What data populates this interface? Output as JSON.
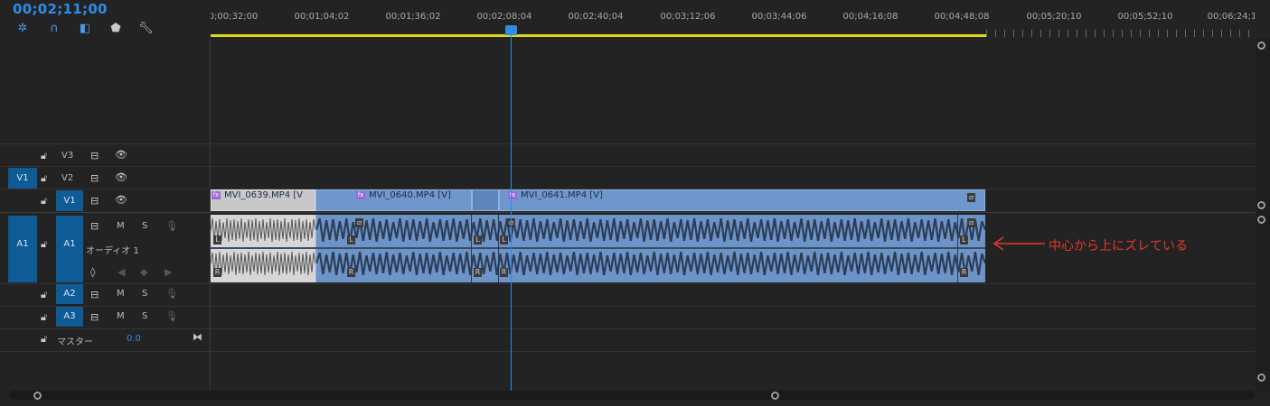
{
  "timecode": "00;02;11;00",
  "toolbar": {
    "icons": [
      "snap-icon",
      "magnet-icon",
      "linked-selection-icon",
      "marker-icon",
      "wrench-icon"
    ]
  },
  "ruler": {
    "labels": [
      "0;00;32;00",
      "00;01;04;02",
      "00;01;36;02",
      "00;02;08;04",
      "00;02;40;04",
      "00;03;12;06",
      "00;03;44;06",
      "00;04;16;08",
      "00;04;48;08",
      "00;05;20;10",
      "00;05;52;10",
      "00;06;24;1"
    ]
  },
  "tracks": {
    "v3": {
      "name": "V3"
    },
    "v2": {
      "name": "V2",
      "source": "V1"
    },
    "v1": {
      "name": "V1"
    },
    "a1": {
      "name": "A1",
      "source": "A1",
      "label": "オーディオ 1"
    },
    "a2": {
      "name": "A2"
    },
    "a3": {
      "name": "A3"
    },
    "master": {
      "label": "マスター",
      "value": "0.0"
    },
    "mute": "M",
    "solo": "S"
  },
  "clips": [
    {
      "name": "MVI_0639.MP4 [V"
    },
    {
      "name": "MVI_0640.MP4 [V]"
    },
    {
      "name": "MVI_0641.MP4 [V]"
    }
  ],
  "channel_letters": {
    "left": "L",
    "right": "R"
  },
  "annotation": "中心から上にズレている",
  "colors": {
    "timecode": "#2d8ceb",
    "clip": "#6f97cc",
    "annotation": "#e03a2a",
    "target": "#0e5b96",
    "work_area": "#e0d90f"
  }
}
